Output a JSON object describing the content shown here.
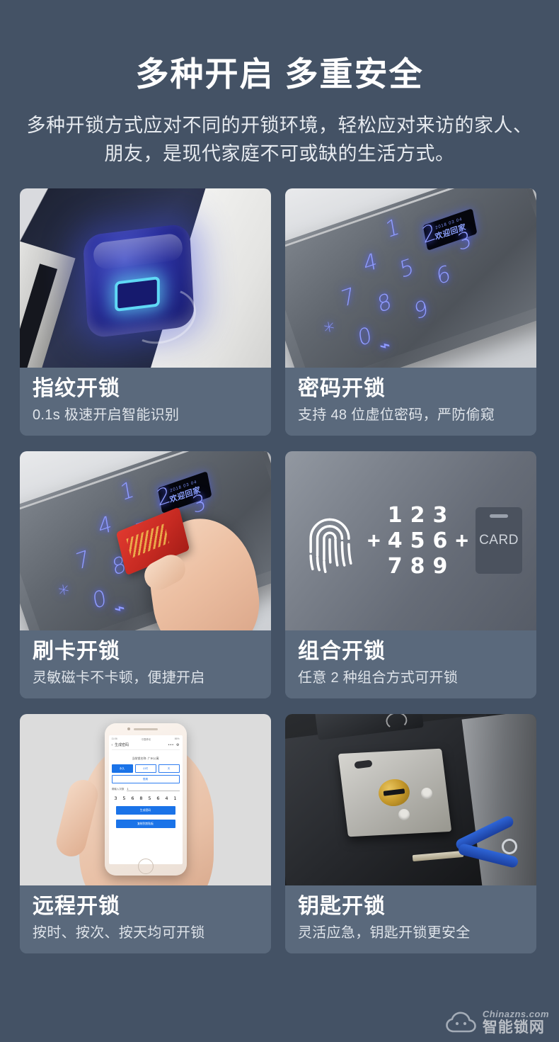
{
  "header": {
    "title": "多种开启 多重安全",
    "subtitle": "多种开锁方式应对不同的开锁环境，轻松应对来访的家人、朋友，是现代家庭不可或缺的生活方式。"
  },
  "colors": {
    "page_background": "#445265",
    "card_label_background": "#5a697c",
    "title_text": "#ffffff",
    "desc_text": "#dfe4ea",
    "keypad_glow": "#8f9bff",
    "accent_blue": "#1a73e8"
  },
  "cards": [
    {
      "id": "fingerprint",
      "title": "指纹开锁",
      "desc": "0.1s 极速开启智能识别"
    },
    {
      "id": "password",
      "title": "密码开锁",
      "desc": "支持 48 位虚位密码，严防偷窥",
      "keypad_keys": [
        "1",
        "2",
        "3",
        "4",
        "5",
        "6",
        "7",
        "8",
        "9",
        "*",
        "0",
        "⌁"
      ],
      "oled_date": "2018 03 04",
      "oled_text": "欢迎回家"
    },
    {
      "id": "card-swipe",
      "title": "刷卡开锁",
      "desc": "灵敏磁卡不卡顿，便捷开启"
    },
    {
      "id": "combination",
      "title": "组合开锁",
      "desc": "任意 2 种组合方式可开锁",
      "combo": {
        "fingerprint_icon": "fingerprint-icon",
        "plus_symbol": "+",
        "digits": [
          "1",
          "2",
          "3",
          "4",
          "5",
          "6",
          "7",
          "8",
          "9"
        ],
        "card_label": "CARD"
      }
    },
    {
      "id": "remote",
      "title": "远程开锁",
      "desc": "按时、按次、按天均可开锁",
      "phone": {
        "status_time": "11:06",
        "status_carrier": "中国移动",
        "status_battery": "86%",
        "nav_title": "生成密码",
        "nav_back": "‹",
        "nav_more": "•••",
        "nav_gear": "⚙",
        "location": "当前锁名称: 广州公寓",
        "chips": [
          "永久",
          "小时",
          "天",
          "限期"
        ],
        "input_label": "请输入次数",
        "input_value": "1",
        "code": [
          "3",
          "5",
          "6",
          "8",
          "5",
          "6",
          "4",
          "1"
        ],
        "btn_primary": "生成密码",
        "btn_secondary": "复制到剪贴板"
      }
    },
    {
      "id": "key",
      "title": "钥匙开锁",
      "desc": "灵活应急，钥匙开锁更安全"
    }
  ],
  "watermark": {
    "icon": "cloud-icon",
    "site": "Chinazns.com",
    "name": "智能锁网"
  }
}
